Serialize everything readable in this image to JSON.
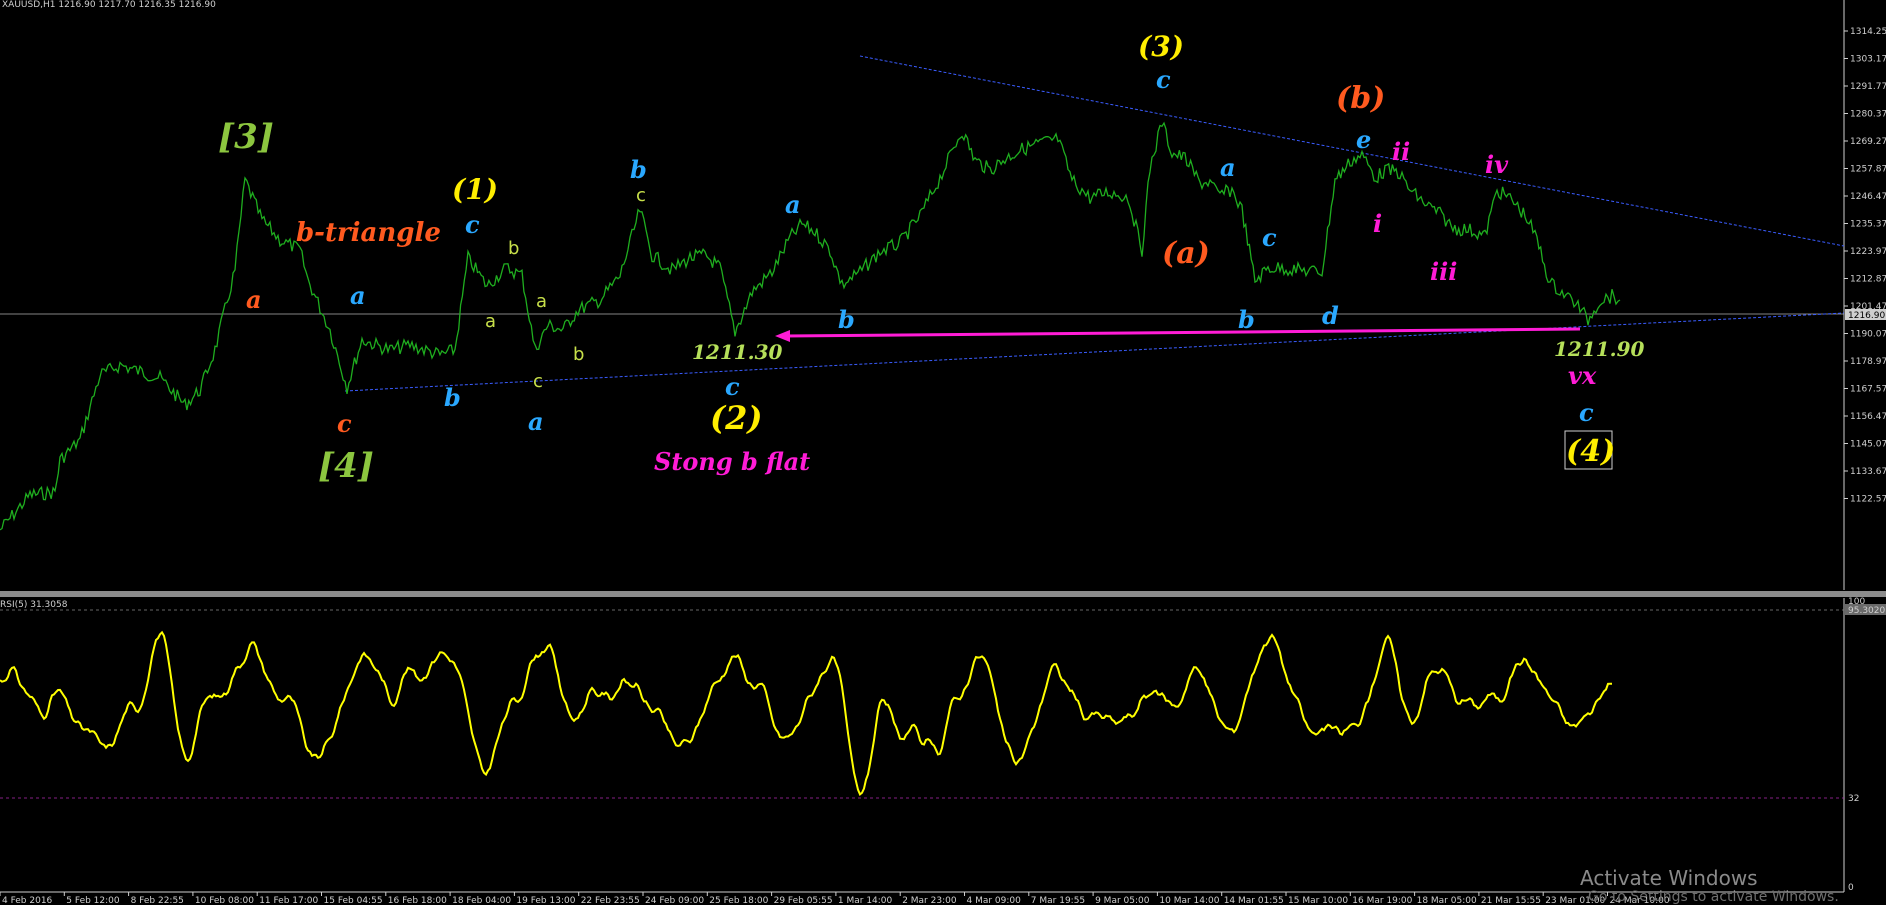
{
  "header": {
    "symbol_info": "XAUUSD,H1  1216.90 1217.70 1216.35 1216.90"
  },
  "colors": {
    "background": "#000000",
    "price_line": "#1fae1f",
    "rsi_line": "#ffff00",
    "trendline": "#3a5cff",
    "arrow": "#ff1cd6"
  },
  "price_axis": {
    "ticks": [
      "1314.25",
      "1303.17",
      "1291.77",
      "1280.37",
      "1269.27",
      "1257.87",
      "1246.47",
      "1235.37",
      "1223.97",
      "1212.87",
      "1201.47",
      "1190.07",
      "1178.97",
      "1167.57",
      "1156.47",
      "1145.07",
      "1133.67",
      "1122.57"
    ],
    "current": "1216.90"
  },
  "time_axis": {
    "ticks": [
      "4 Feb 2016",
      "5 Feb 12:00",
      "8 Feb 22:55",
      "10 Feb 08:00",
      "11 Feb 17:00",
      "15 Feb 04:55",
      "16 Feb 18:00",
      "18 Feb 04:00",
      "19 Feb 13:00",
      "22 Feb 23:55",
      "24 Feb 09:00",
      "25 Feb 18:00",
      "29 Feb 05:55",
      "1 Mar 14:00",
      "2 Mar 23:00",
      "4 Mar 09:00",
      "7 Mar 19:55",
      "9 Mar 05:00",
      "10 Mar 14:00",
      "14 Mar 01:55",
      "15 Mar 10:00",
      "16 Mar 19:00",
      "18 Mar 05:00",
      "21 Mar 15:55",
      "23 Mar 01:00",
      "24 Mar 10:00"
    ]
  },
  "rsi": {
    "label": "RSI(5) 31.3058",
    "axis": {
      "top_scale": "100",
      "top_value": "95.3020",
      "mid": "32",
      "bottom": "0"
    }
  },
  "annotations": {
    "w3_bracket": "[3]",
    "w4_bracket": "[4]",
    "b_triangle": "b-triangle",
    "w1": "(1)",
    "w2": "(2)",
    "w3": "(3)",
    "w4": "(4)",
    "wa": "(a)",
    "wb": "(b)",
    "price_1211_30": "1211.30",
    "price_1211_90": "1211.90",
    "strong_b_flat": "Stong b flat",
    "small_a": "a",
    "small_b": "b",
    "small_c": "c",
    "small_d": "d",
    "small_e": "e",
    "small_vx": "vx",
    "roman_i": "i",
    "roman_ii": "ii",
    "roman_iii": "iii",
    "roman_iv": "iv"
  },
  "watermark": {
    "line1": "Activate Windows",
    "line2": "Go to Settings to activate Windows."
  }
}
